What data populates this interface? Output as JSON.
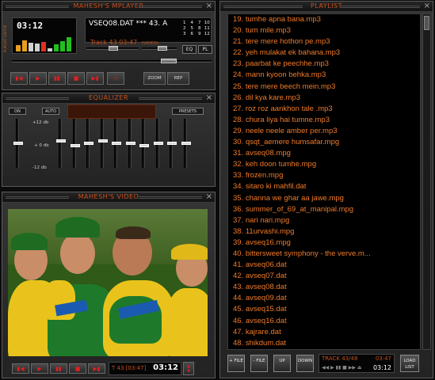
{
  "player": {
    "title": "MAHESH'S MPLAYER",
    "time": "03:12",
    "filename": "VSEQ08.DAT *** 43. A",
    "track_info": "Track 43 03:47",
    "track_mode": "(VIDEO)",
    "side_label": "PLAYLIST EDITOR",
    "numpad": [
      "1",
      "4",
      "7",
      "10",
      "2",
      "5",
      "8",
      "11",
      "3",
      "6",
      "9",
      "12"
    ],
    "eq_btn": "EQ",
    "pl_btn": "PL",
    "zoom_label": "ZOOM",
    "rep_label": "REP"
  },
  "equalizer": {
    "title": "EQUALIZER",
    "on_label": "ON",
    "auto_label": "AUTO",
    "presets_label": "PRESETS",
    "db_top": "+12 db",
    "db_mid": "+ 0 db",
    "db_bot": "-12 db",
    "preamp_level": 0.5,
    "band_levels": [
      0.55,
      0.45,
      0.5,
      0.55,
      0.5,
      0.5,
      0.45,
      0.5,
      0.5,
      0.5
    ]
  },
  "video": {
    "title": "MAHESH'S VIDEO",
    "track_time": "T 43 [03:47]",
    "elapsed": "03:12",
    "image_label": "cricket team celebrating (video frame)"
  },
  "playlist": {
    "title": "PLAYLIST",
    "items": [
      "19. tumhe apna bana.mp3",
      "20. tum mile.mp3",
      "21. tere mere hothon pe.mp3",
      "22. yeh mulakat ek bahana.mp3",
      "23. paarbat ke peechhe.mp3",
      "24. mann kyoon behka.mp3",
      "25. tere mere beech mein.mp3",
      "26. dil kya kare.mp3",
      "27. roz roz aankhon tale .mp3",
      "28. chura liya hai tumne.mp3",
      "29. neele neele amber per.mp3",
      "30. qsqt_aemere humsafar.mpg",
      "31. avseq08.mpg",
      "32. keh doon tumhe.mpg",
      "33. frozen.mpg",
      "34. sitaro ki mahfil.dat",
      "35. channa we ghar aa jawe.mpg",
      "36. summer_of_69_at_manipal.mpg",
      "37. nari nari.mpg",
      "38. 11urvashi.mpg",
      "39. avseq16.mpg",
      "40. bittersweet symphony - the verve.m...",
      "41. avseq06.dat",
      "42. avseq07.dat",
      "43. avseq08.dat",
      "44. avseq09.dat",
      "45. avseq15.dat",
      "46. avseq16.dat",
      "47. kajrare.dat",
      "48. shikdum.dat"
    ],
    "buttons": {
      "add": "+ FILE",
      "remove": "- FILE",
      "up": "UP",
      "down": "DOWN",
      "load": "LOAD LIST"
    },
    "track_status": "TRACK 43/48",
    "track_duration": "03:47",
    "elapsed": "03:12"
  }
}
